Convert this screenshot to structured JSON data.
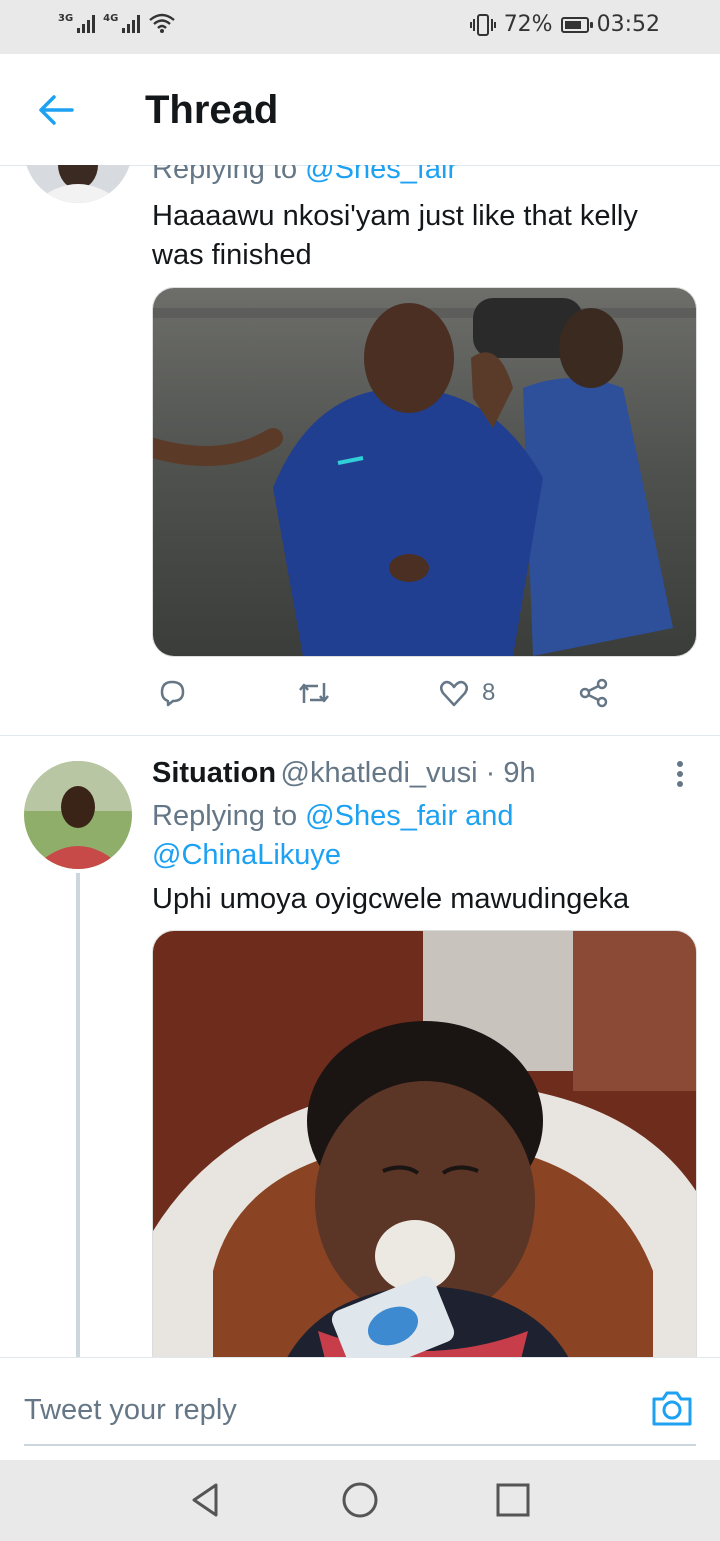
{
  "status_bar": {
    "network1": "3G",
    "network2": "4G",
    "battery": "72%",
    "time": "03:52"
  },
  "header": {
    "title": "Thread"
  },
  "tweets": [
    {
      "replying_prefix": "Replying to ",
      "replying_to": "@Shes_fair",
      "text": "Haaaawu nkosi'yam just like that kelly was finished",
      "image": "photo-coach-high-five",
      "likes": "8"
    },
    {
      "name": "Situation",
      "handle": "@khatledi_vusi",
      "time": "9h",
      "replying_prefix": "Replying to ",
      "replying_to_1": "@Shes_fair",
      "replying_and": " and",
      "replying_to_2": "@ChinaLikuye",
      "text": "Uphi umoya oyigcwele mawudingeka",
      "image": "photo-child-eating-yogurt"
    }
  ],
  "reply_bar": {
    "placeholder": "Tweet your reply"
  },
  "colors": {
    "accent": "#1da1f2",
    "secondary_text": "#657786",
    "divider": "#e1e8ed"
  }
}
